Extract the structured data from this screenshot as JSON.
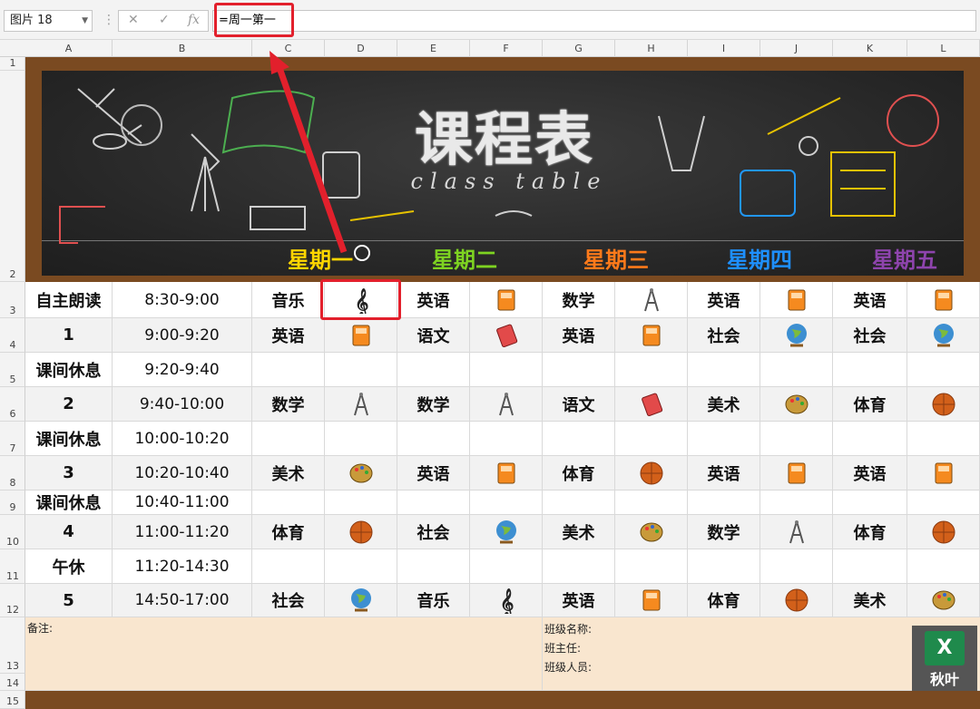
{
  "formula_bar": {
    "name_box": "图片 18",
    "cancel_icon": "✕",
    "confirm_icon": "✓",
    "fx_label": "fx",
    "formula": "=周一第一"
  },
  "columns": [
    "A",
    "B",
    "C",
    "D",
    "E",
    "F",
    "G",
    "H",
    "I",
    "J",
    "K",
    "L"
  ],
  "rows": [
    "1",
    "2",
    "3",
    "4",
    "5",
    "6",
    "7",
    "8",
    "9",
    "10",
    "11",
    "12",
    "13",
    "14",
    "15"
  ],
  "banner": {
    "title": "课程表",
    "subtitle": "class table",
    "days": [
      "星期一",
      "星期二",
      "星期三",
      "星期四",
      "星期五"
    ]
  },
  "schedule": [
    {
      "period": "自主朗读",
      "time": "8:30-9:00",
      "classes": [
        [
          "音乐",
          "treble-clef-icon"
        ],
        [
          "英语",
          "book-icon"
        ],
        [
          "数学",
          "compass-icon"
        ],
        [
          "英语",
          "book-icon"
        ],
        [
          "英语",
          "book-icon"
        ]
      ]
    },
    {
      "period": "1",
      "time": "9:00-9:20",
      "classes": [
        [
          "英语",
          "book-icon"
        ],
        [
          "语文",
          "red-book-icon"
        ],
        [
          "英语",
          "book-icon"
        ],
        [
          "社会",
          "globe-icon"
        ],
        [
          "社会",
          "globe-icon"
        ]
      ]
    },
    {
      "period": "课间休息",
      "time": "9:20-9:40",
      "classes": []
    },
    {
      "period": "2",
      "time": "9:40-10:00",
      "classes": [
        [
          "数学",
          "compass-icon"
        ],
        [
          "数学",
          "compass-icon"
        ],
        [
          "语文",
          "red-book-icon"
        ],
        [
          "美术",
          "palette-icon"
        ],
        [
          "体育",
          "basketball-icon"
        ]
      ]
    },
    {
      "period": "课间休息",
      "time": "10:00-10:20",
      "classes": []
    },
    {
      "period": "3",
      "time": "10:20-10:40",
      "classes": [
        [
          "美术",
          "palette-icon"
        ],
        [
          "英语",
          "book-icon"
        ],
        [
          "体育",
          "basketball-icon"
        ],
        [
          "英语",
          "book-icon"
        ],
        [
          "英语",
          "book-icon"
        ]
      ]
    },
    {
      "period": "课间休息",
      "time": "10:40-11:00",
      "classes": []
    },
    {
      "period": "4",
      "time": "11:00-11:20",
      "classes": [
        [
          "体育",
          "basketball-icon"
        ],
        [
          "社会",
          "globe-icon"
        ],
        [
          "美术",
          "palette-icon"
        ],
        [
          "数学",
          "compass-icon"
        ],
        [
          "体育",
          "basketball-icon"
        ]
      ]
    },
    {
      "period": "午休",
      "time": "11:20-14:30",
      "classes": []
    },
    {
      "period": "5",
      "time": "14:50-17:00",
      "classes": [
        [
          "社会",
          "globe-icon"
        ],
        [
          "音乐",
          "treble-clef-icon"
        ],
        [
          "英语",
          "book-icon"
        ],
        [
          "体育",
          "basketball-icon"
        ],
        [
          "美术",
          "palette-icon"
        ]
      ]
    }
  ],
  "footer": {
    "note_label": "备注:",
    "class_name_label": "班级名称:",
    "teacher_label": "班主任:",
    "members_label": "班级人员:"
  },
  "logo": {
    "glyph": "X",
    "text": "秋叶"
  },
  "colors": {
    "day1": "#ffd600",
    "day2": "#7ed321",
    "day3": "#ff7a1a",
    "day4": "#1e90ff",
    "day5": "#8e44ad",
    "accent": "#e2202c"
  }
}
